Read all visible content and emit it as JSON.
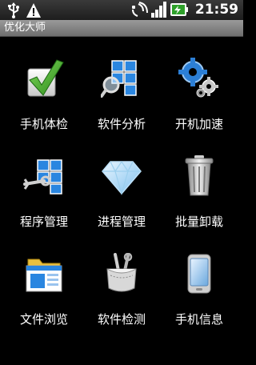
{
  "status_bar": {
    "time": "21:59",
    "icons": [
      "usb-icon",
      "warning-icon",
      "signal-icon",
      "battery-charging-icon"
    ]
  },
  "app": {
    "title": "优化大师"
  },
  "grid": {
    "items": [
      {
        "label": "手机体检",
        "icon": "checkmark-icon"
      },
      {
        "label": "软件分析",
        "icon": "magnifier-windows-icon"
      },
      {
        "label": "开机加速",
        "icon": "gears-icon"
      },
      {
        "label": "程序管理",
        "icon": "windows-wrench-icon"
      },
      {
        "label": "进程管理",
        "icon": "diamond-icon"
      },
      {
        "label": "批量卸载",
        "icon": "trash-can-icon"
      },
      {
        "label": "文件浏览",
        "icon": "folder-window-icon"
      },
      {
        "label": "软件检测",
        "icon": "tools-pocket-icon"
      },
      {
        "label": "手机信息",
        "icon": "phone-icon"
      }
    ]
  },
  "colors": {
    "background": "#000000",
    "status_bar": "#2a2a2a",
    "title_bar": "#888888",
    "text": "#ffffff",
    "accent_blue": "#2a7fd8",
    "accent_green": "#3aa02a"
  }
}
